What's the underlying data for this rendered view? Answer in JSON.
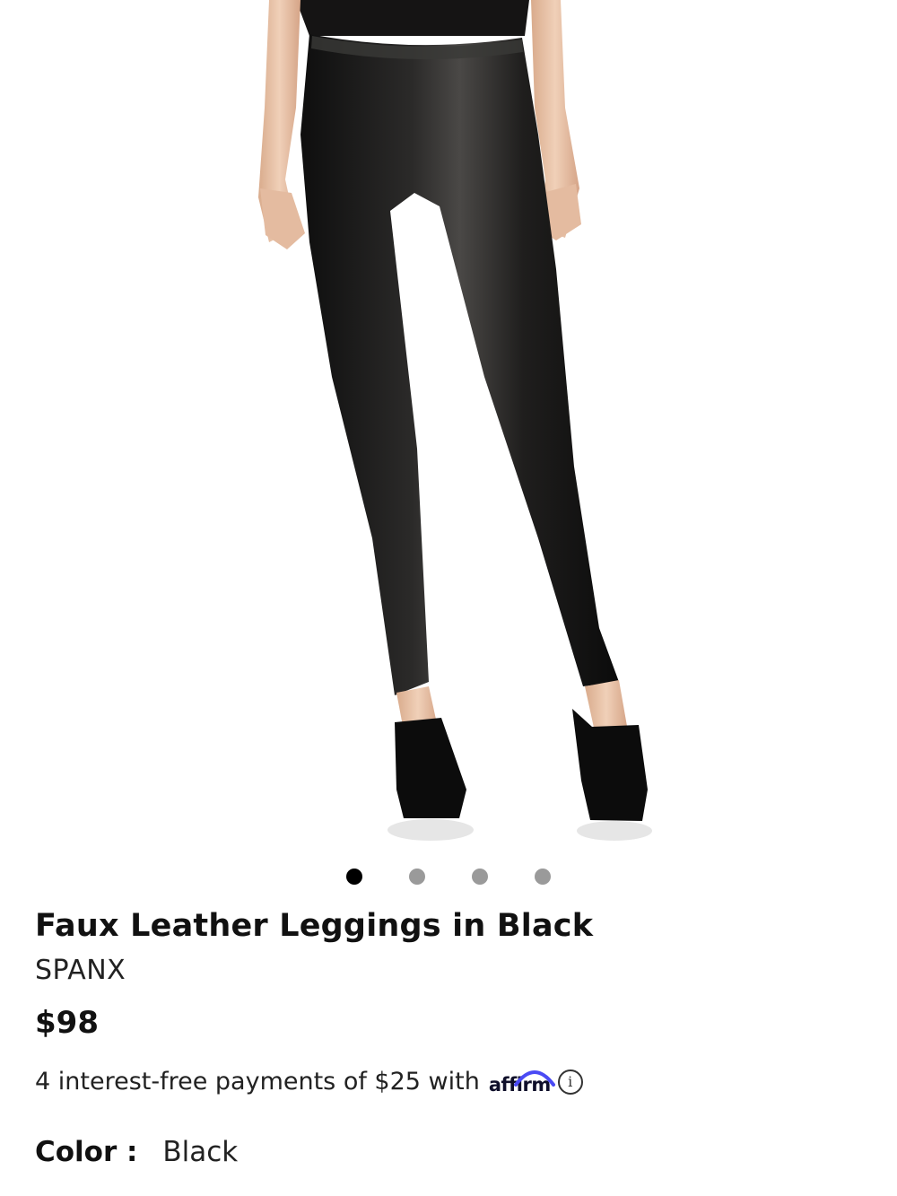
{
  "product": {
    "image_alt": "Model wearing black faux leather leggings with black pumps",
    "title": "Faux Leather Leggings in Black",
    "brand": "SPANX",
    "price": "$98",
    "installments_text": "4 interest-free payments of $25 with",
    "affirm_logo": "affirm",
    "info_icon_glyph": "i",
    "color_label": "Color :",
    "color_value": "Black"
  },
  "carousel": {
    "total_slides": 4,
    "active_index": 0
  },
  "colors": {
    "accent_affirm": "#4a4af4",
    "legging": "#1c1b1b",
    "skin": "#e9c7ae"
  },
  "icons": {
    "info": "info-circle-icon",
    "affirm_arc": "affirm-arc-icon"
  }
}
